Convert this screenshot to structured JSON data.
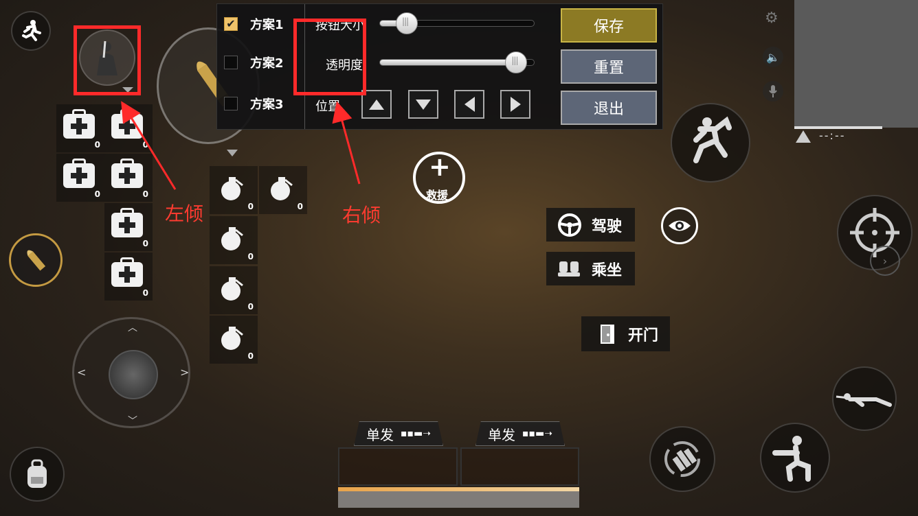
{
  "layout_panel": {
    "schemes": [
      {
        "label": "方案1",
        "checked": true
      },
      {
        "label": "方案2",
        "checked": false
      },
      {
        "label": "方案3",
        "checked": false
      }
    ],
    "button_size_label": "按钮大小",
    "button_size_value": 0.12,
    "opacity_label": "透明度",
    "opacity_value": 0.95,
    "position_label": "位置",
    "save_label": "保存",
    "reset_label": "重置",
    "exit_label": "退出"
  },
  "annotations": {
    "left_lean": "左倾",
    "right_lean": "右倾"
  },
  "rescue_label": "救援",
  "vehicle": {
    "drive_label": "驾驶",
    "ride_label": "乘坐"
  },
  "door_label": "开门",
  "inventory": {
    "medkit_counts": [
      "0",
      "0",
      "0",
      "0",
      "0",
      "0"
    ],
    "grenade_counts": [
      "0",
      "0",
      "0",
      "0",
      "0"
    ]
  },
  "weapons": {
    "slot1_mode": "单发",
    "slot2_mode": "单发"
  },
  "minimap": {
    "time": "--:--"
  },
  "colors": {
    "save_button": "#8c7a24",
    "reset_button": "#5d6677",
    "exit_button": "#5d6677",
    "annotation": "#ff2a2a",
    "checkbox_checked": "#f0c36a"
  }
}
